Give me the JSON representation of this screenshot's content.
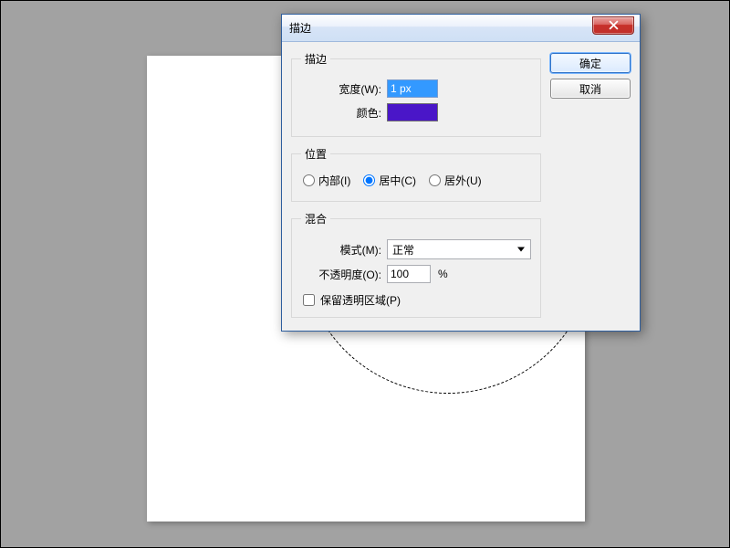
{
  "dialog": {
    "title": "描边",
    "close_tooltip": "关闭"
  },
  "buttons": {
    "ok": "确定",
    "cancel": "取消"
  },
  "stroke": {
    "legend": "描边",
    "width_label": "宽度(W):",
    "width_value": "1 px",
    "color_label": "颜色:",
    "color_value": "#4a16c8"
  },
  "position": {
    "legend": "位置",
    "inside": "内部(I)",
    "center": "居中(C)",
    "outside": "居外(U)",
    "selected": "center"
  },
  "blend": {
    "legend": "混合",
    "mode_label": "模式(M):",
    "mode_value": "正常",
    "opacity_label": "不透明度(O):",
    "opacity_value": "100",
    "opacity_unit": "%",
    "preserve_label": "保留透明区域(P)",
    "preserve_checked": false
  }
}
